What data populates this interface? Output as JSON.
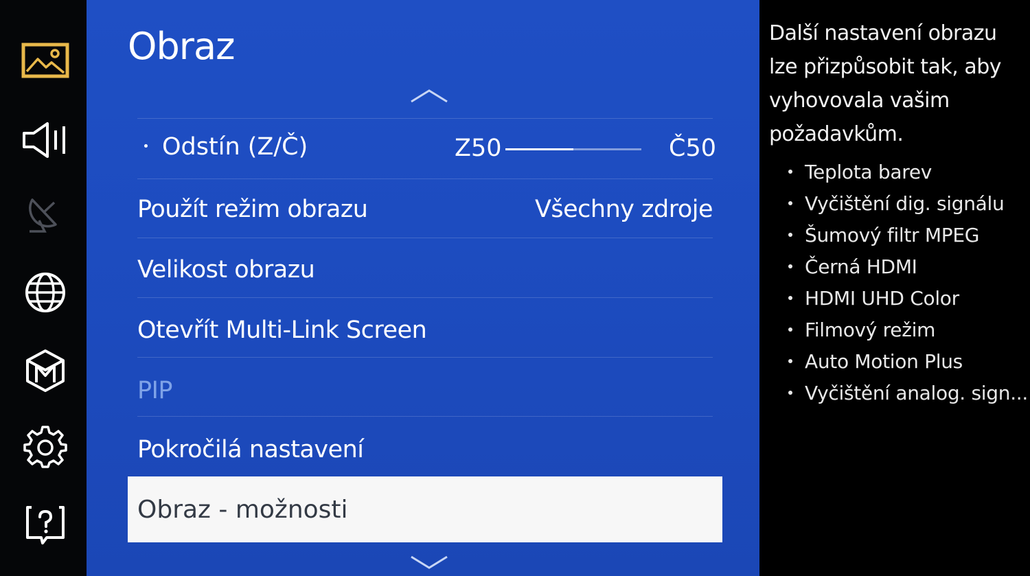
{
  "sidebar": {
    "items": [
      {
        "icon": "picture-icon",
        "active": true
      },
      {
        "icon": "sound-icon",
        "active": false
      },
      {
        "icon": "broadcast-icon",
        "active": false,
        "disabled": true
      },
      {
        "icon": "network-globe-icon",
        "active": false
      },
      {
        "icon": "smart-hub-icon",
        "active": false
      },
      {
        "icon": "settings-gear-icon",
        "active": false
      },
      {
        "icon": "support-help-icon",
        "active": false
      }
    ],
    "active_color": "#e8b84a"
  },
  "menu": {
    "title": "Obraz",
    "tint": {
      "label": "Odstín (Z/Č)",
      "left_value": "Z50",
      "right_value": "Č50",
      "level": 0.5
    },
    "items": [
      {
        "label": "Použít režim obrazu",
        "value": "Všechny zdroje"
      },
      {
        "label": "Velikost obrazu",
        "value": ""
      },
      {
        "label": "Otevřít Multi-Link Screen",
        "value": ""
      },
      {
        "label": "PIP",
        "value": "",
        "disabled": true
      },
      {
        "label": "Pokročilá nastavení",
        "value": ""
      }
    ],
    "selected": {
      "label": "Obraz - možnosti"
    },
    "accent_color": "#1f4fc4"
  },
  "info": {
    "description": "Další nastavení obrazu lze přizpůsobit tak, aby vyhovovala vašim požadavkům.",
    "options": [
      "Teplota barev",
      "Vyčištění dig. signálu",
      "Šumový filtr MPEG",
      "Černá HDMI",
      "HDMI UHD Color",
      "Filmový režim",
      "Auto Motion Plus",
      "Vyčištění analog. sign..."
    ]
  }
}
